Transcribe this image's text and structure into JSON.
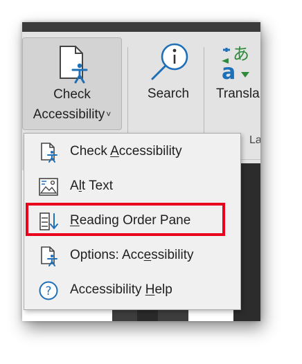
{
  "ribbon": {
    "check_accessibility": {
      "line1": "Check",
      "line2": "Accessibility",
      "caret": "˅"
    },
    "search": {
      "label": "Search"
    },
    "translate": {
      "label": "Transla",
      "icon_text_top": "あ",
      "icon_text_bottom": "a"
    },
    "group_label": "La"
  },
  "menu": {
    "items": [
      {
        "pre": "Check ",
        "key": "A",
        "post": "ccessibility",
        "icon": "document-accessibility-icon"
      },
      {
        "pre": "A",
        "key": "l",
        "post": "t Text",
        "icon": "alt-text-icon"
      },
      {
        "pre": "",
        "key": "R",
        "post": "eading Order Pane",
        "icon": "reading-order-icon",
        "highlighted": true
      },
      {
        "pre": "Options: Acc",
        "key": "e",
        "post": "ssibility",
        "icon": "accessibility-options-icon"
      },
      {
        "pre": "Accessibility ",
        "key": "H",
        "post": "elp",
        "icon": "help-icon"
      }
    ]
  },
  "colors": {
    "highlight": "#e8001c",
    "icon_blue": "#1d6fb8",
    "ribbon_bg": "#e3e3e3",
    "menu_bg": "#f0f0f0"
  }
}
